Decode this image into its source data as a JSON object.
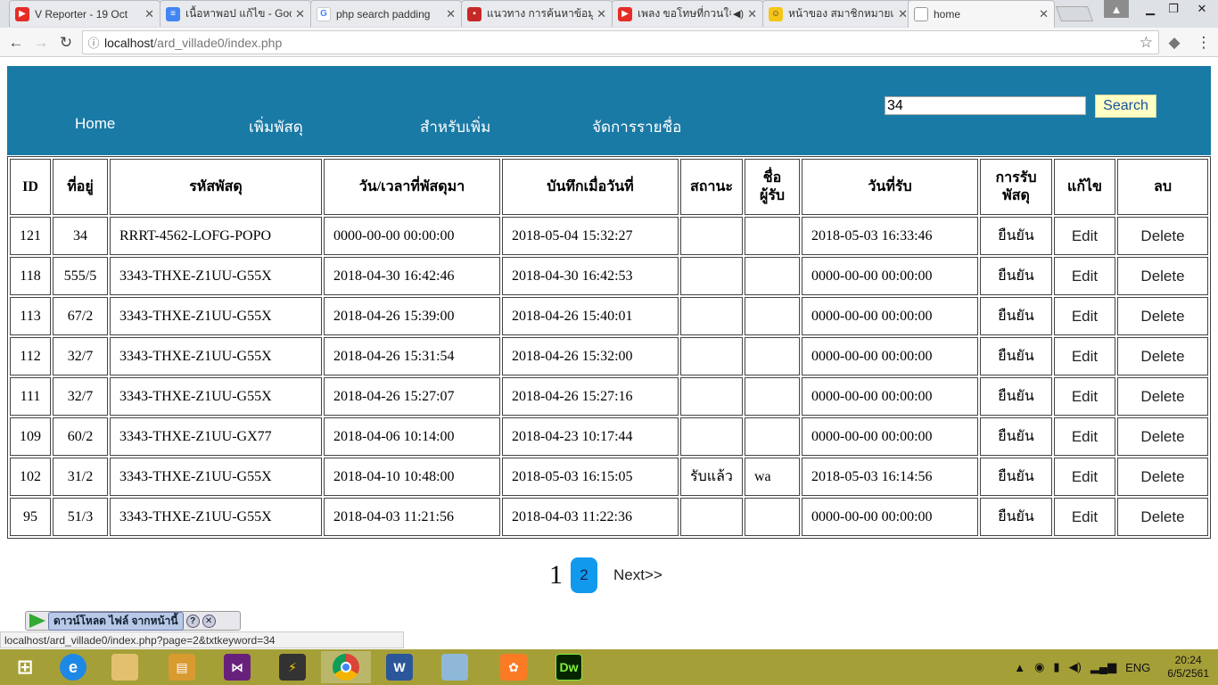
{
  "browser": {
    "tabs": [
      {
        "title": "V Reporter - 19 Oct",
        "icon": "youtube-icon",
        "color": "#e52d27"
      },
      {
        "title": "เนื้อหาพอป แก้ไข - Goo",
        "icon": "google-docs-icon",
        "color": "#4285f4"
      },
      {
        "title": "php search padding",
        "icon": "google-icon",
        "color": "#4285f4"
      },
      {
        "title": "แนวทาง การค้นหาข้อมูล",
        "icon": "site-icon",
        "color": "#c62828"
      },
      {
        "title": "เพลง ขอโทษที่กวนใจ",
        "icon": "youtube-icon",
        "color": "#e52d27"
      },
      {
        "title": "หน้าของ สมาชิกหมายเ",
        "icon": "emoji-icon",
        "color": "#f5c518"
      },
      {
        "title": "home",
        "icon": "page-icon",
        "color": "#9e9e9e"
      }
    ],
    "url_host": "localhost",
    "url_path": "/ard_villade0/index.php"
  },
  "nav": {
    "items": [
      "Home",
      "เพิ่มพัสดุ",
      "สำหรับเพิ่ม",
      "จัดการรายชื่อ"
    ],
    "search_value": "34",
    "search_button": "Search"
  },
  "table": {
    "headers": {
      "id": "ID",
      "addr": "ที่อยู่",
      "code": "รหัสพัสดุ",
      "arrived": "วัน/เวลาที่พัสดุมา",
      "recorded": "บันทึกเมื่อวันที่",
      "status": "สถานะ",
      "receiver_l1": "ชื่อ",
      "receiver_l2": "ผู้รับ",
      "received": "วันที่รับ",
      "confirm_l1": "การรับ",
      "confirm_l2": "พัสดุ",
      "edit": "แก้ไข",
      "delete": "ลบ"
    },
    "rows": [
      {
        "id": "121",
        "addr": "34",
        "code": "RRRT-4562-LOFG-POPO",
        "arrived": "0000-00-00 00:00:00",
        "recorded": "2018-05-04 15:32:27",
        "status": "",
        "receiver": "",
        "received": "2018-05-03 16:33:46",
        "confirm": "ยืนยัน",
        "edit": "Edit",
        "delete": "Delete"
      },
      {
        "id": "118",
        "addr": "555/5",
        "code": "3343-THXE-Z1UU-G55X",
        "arrived": "2018-04-30 16:42:46",
        "recorded": "2018-04-30 16:42:53",
        "status": "",
        "receiver": "",
        "received": "0000-00-00 00:00:00",
        "confirm": "ยืนยัน",
        "edit": "Edit",
        "delete": "Delete"
      },
      {
        "id": "113",
        "addr": "67/2",
        "code": "3343-THXE-Z1UU-G55X",
        "arrived": "2018-04-26 15:39:00",
        "recorded": "2018-04-26 15:40:01",
        "status": "",
        "receiver": "",
        "received": "0000-00-00 00:00:00",
        "confirm": "ยืนยัน",
        "edit": "Edit",
        "delete": "Delete"
      },
      {
        "id": "112",
        "addr": "32/7",
        "code": "3343-THXE-Z1UU-G55X",
        "arrived": "2018-04-26 15:31:54",
        "recorded": "2018-04-26 15:32:00",
        "status": "",
        "receiver": "",
        "received": "0000-00-00 00:00:00",
        "confirm": "ยืนยัน",
        "edit": "Edit",
        "delete": "Delete"
      },
      {
        "id": "111",
        "addr": "32/7",
        "code": "3343-THXE-Z1UU-G55X",
        "arrived": "2018-04-26 15:27:07",
        "recorded": "2018-04-26 15:27:16",
        "status": "",
        "receiver": "",
        "received": "0000-00-00 00:00:00",
        "confirm": "ยืนยัน",
        "edit": "Edit",
        "delete": "Delete"
      },
      {
        "id": "109",
        "addr": "60/2",
        "code": "3343-THXE-Z1UU-GX77",
        "arrived": "2018-04-06 10:14:00",
        "recorded": "2018-04-23 10:17:44",
        "status": "",
        "receiver": "",
        "received": "0000-00-00 00:00:00",
        "confirm": "ยืนยัน",
        "edit": "Edit",
        "delete": "Delete"
      },
      {
        "id": "102",
        "addr": "31/2",
        "code": "3343-THXE-Z1UU-G55X",
        "arrived": "2018-04-10 10:48:00",
        "recorded": "2018-05-03 16:15:05",
        "status": "รับแล้ว",
        "receiver": "wa",
        "received": "2018-05-03 16:14:56",
        "confirm": "ยืนยัน",
        "edit": "Edit",
        "delete": "Delete"
      },
      {
        "id": "95",
        "addr": "51/3",
        "code": "3343-THXE-Z1UU-G55X",
        "arrived": "2018-04-03 11:21:56",
        "recorded": "2018-04-03 11:22:36",
        "status": "",
        "receiver": "",
        "received": "0000-00-00 00:00:00",
        "confirm": "ยืนยัน",
        "edit": "Edit",
        "delete": "Delete"
      }
    ]
  },
  "pager": {
    "current": "1",
    "page2": "2",
    "next": "Next>>"
  },
  "download_bar": {
    "label": "ดาวน์โหลด ไฟล์ จากหน้านี้"
  },
  "status_url": "localhost/ard_villade0/index.php?page=2&txtkeyword=34",
  "taskbar": {
    "apps": [
      "windows-start-icon",
      "internet-explorer-icon",
      "file-explorer-icon",
      "notes-icon",
      "visual-studio-icon",
      "winamp-icon",
      "chrome-icon",
      "word-icon",
      "notepad-icon",
      "xampp-icon",
      "dreamweaver-icon"
    ],
    "lang": "ENG",
    "time": "20:24",
    "date": "6/5/2561"
  },
  "colors": {
    "banner": "#1a7aa6",
    "search_button_bg": "#ffffc4",
    "pager_active": "#1199ee",
    "taskbar": "#a59f38"
  }
}
